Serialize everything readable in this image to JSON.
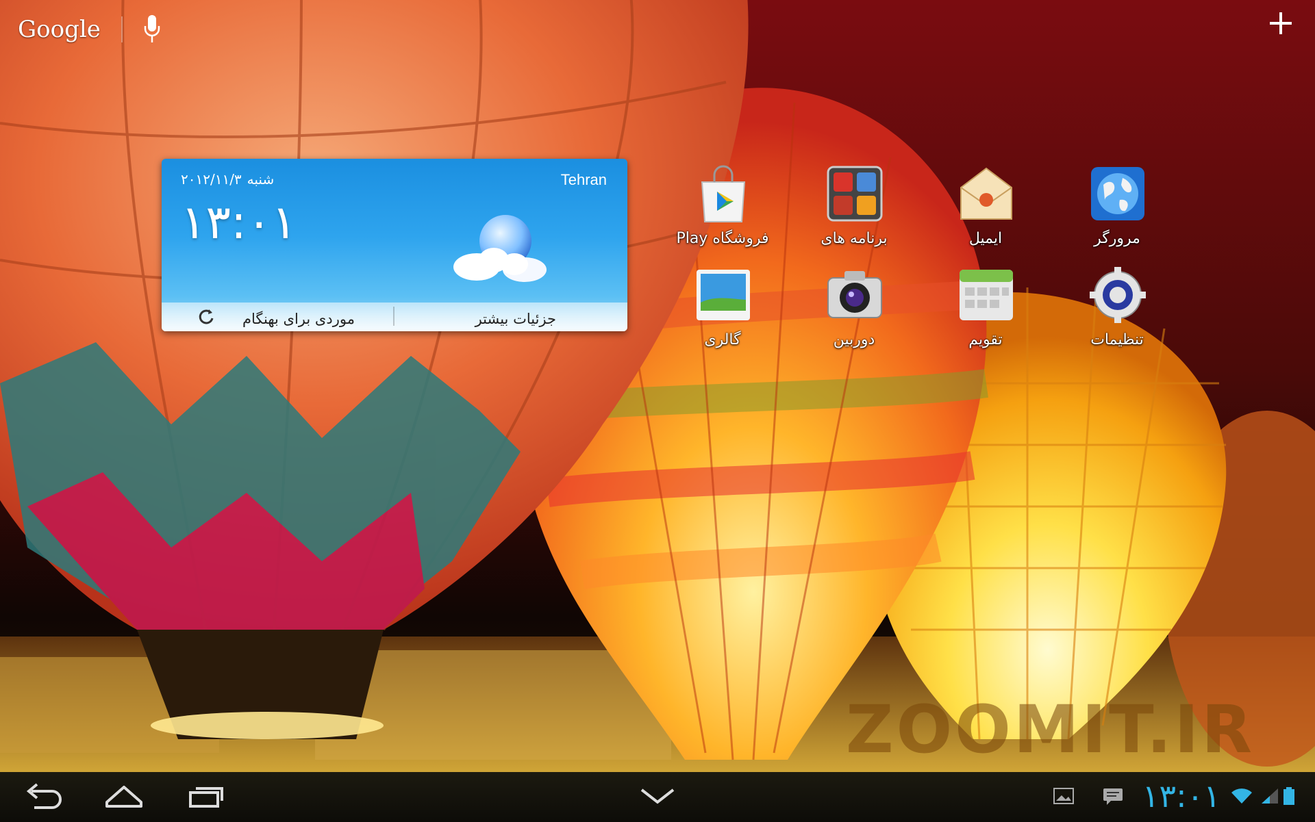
{
  "search": {
    "label": "Google",
    "icon": "mic-icon"
  },
  "topbar": {
    "add_icon": "plus-icon"
  },
  "weather": {
    "city": "Tehran",
    "day": "شنبه",
    "date": "۲۰۱۲/۱۱/۳",
    "time": "۱۳:۰۱",
    "details_label": "جزئیات بیشتر",
    "alarm_label": "موردی برای بهنگام",
    "condition_icon": "partly-cloudy-icon"
  },
  "apps": [
    {
      "label": "Play فروشگاه",
      "icon": "play-store-icon"
    },
    {
      "label": "برنامه های",
      "icon": "apps-folder-icon"
    },
    {
      "label": "ایمیل",
      "icon": "email-icon"
    },
    {
      "label": "مرورگر",
      "icon": "browser-icon"
    },
    {
      "label": "گالری",
      "icon": "gallery-icon"
    },
    {
      "label": "دوربین",
      "icon": "camera-icon"
    },
    {
      "label": "تقویم",
      "icon": "calendar-icon"
    },
    {
      "label": "تنظیمات",
      "icon": "settings-icon"
    }
  ],
  "navbar": {
    "buttons": [
      "back-icon",
      "home-icon",
      "recent-apps-icon",
      "hide-keyboard-icon"
    ],
    "status_time": "۱۳:۰۱",
    "status_icons": [
      "screenshot-notification-icon",
      "message-notification-icon",
      "wifi-icon",
      "signal-icon",
      "battery-icon"
    ]
  },
  "watermark": "ZOOMIT.IR",
  "colors": {
    "accent": "#33b5e5",
    "widget_blue": "#2ea4ee"
  }
}
